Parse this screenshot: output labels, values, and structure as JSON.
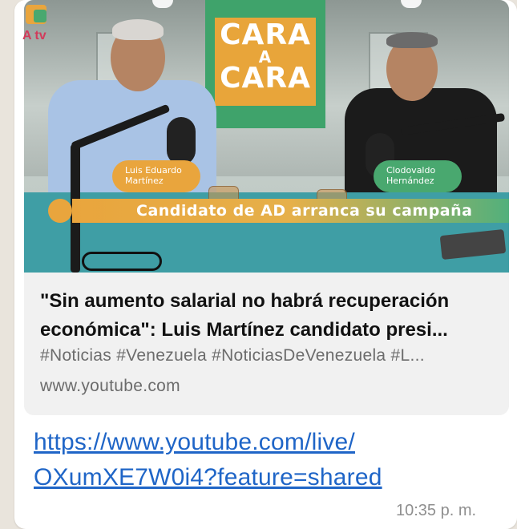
{
  "preview": {
    "thumbnail": {
      "show_title": [
        "CARA",
        "A",
        "CARA"
      ],
      "guest_left_name": [
        "Luis Eduardo",
        "Martínez"
      ],
      "guest_right_name": [
        "Clodovaldo",
        "Hernández"
      ],
      "banner": "Candidato de AD arranca su campaña",
      "channel_logo": "A tv"
    },
    "title_line1": "\"Sin aumento salarial no habrá recuperación",
    "title_line2": "económica\": Luis Martínez candidato presi...",
    "tags": "#Noticias #Venezuela #NoticiasDeVenezuela #L...",
    "domain": "www.youtube.com"
  },
  "message": {
    "link_line1": "https://www.youtube.com/live/",
    "link_line2": "OXumXE7W0i4?feature=shared",
    "time": "10:35 p. m."
  },
  "colors": {
    "link": "#1f65c7",
    "card_bg": "#f1f1f1",
    "chat_bg": "#e9e4dc",
    "brand_orange": "#e9a53d",
    "brand_green": "#49a86f"
  }
}
